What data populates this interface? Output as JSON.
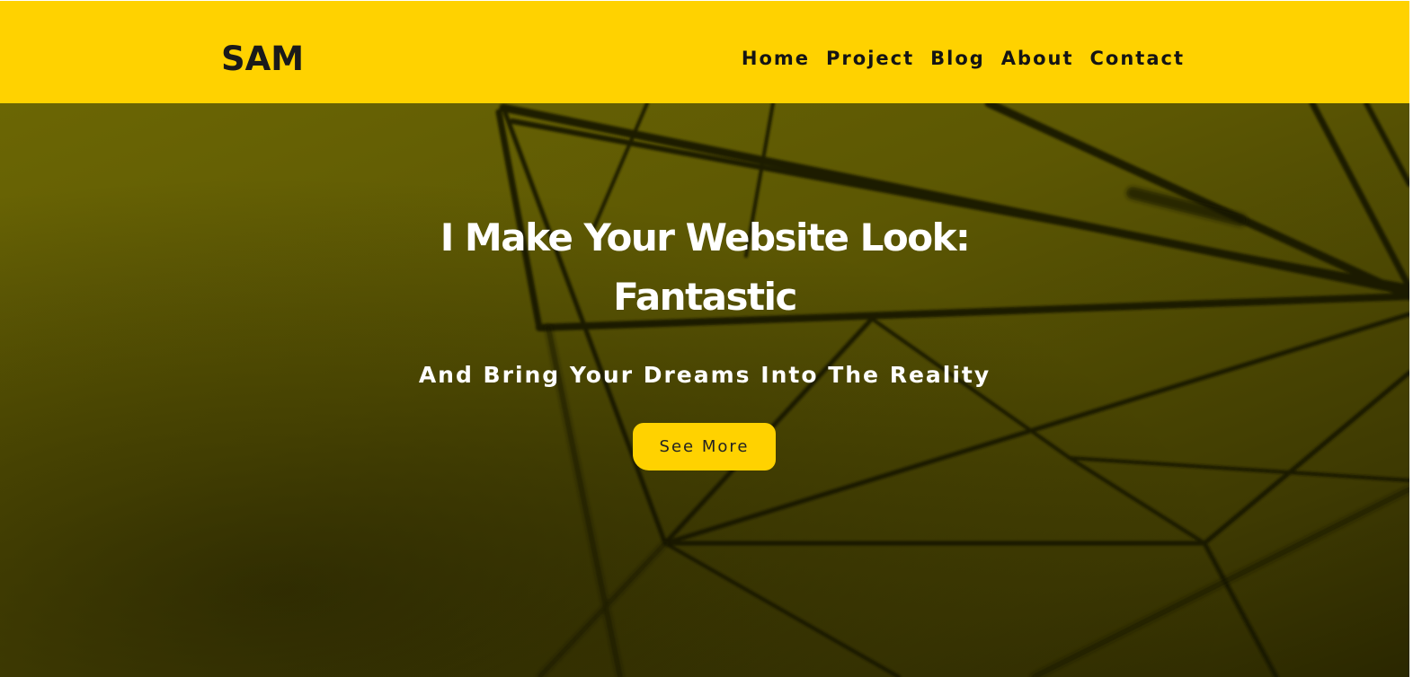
{
  "header": {
    "logo": "SAM",
    "nav": [
      {
        "label": "Home"
      },
      {
        "label": "Project"
      },
      {
        "label": "Blog"
      },
      {
        "label": "About"
      },
      {
        "label": "Contact"
      }
    ]
  },
  "hero": {
    "title_line1": "I Make Your Website Look:",
    "title_line2": "Fantastic",
    "subtitle": "And Bring Your Dreams Into The Reality",
    "cta_label": "See More"
  },
  "colors": {
    "accent": "#ffd200",
    "hero_overlay": "#5c5703",
    "text_light": "#ffffff",
    "text_dark": "#141414"
  }
}
